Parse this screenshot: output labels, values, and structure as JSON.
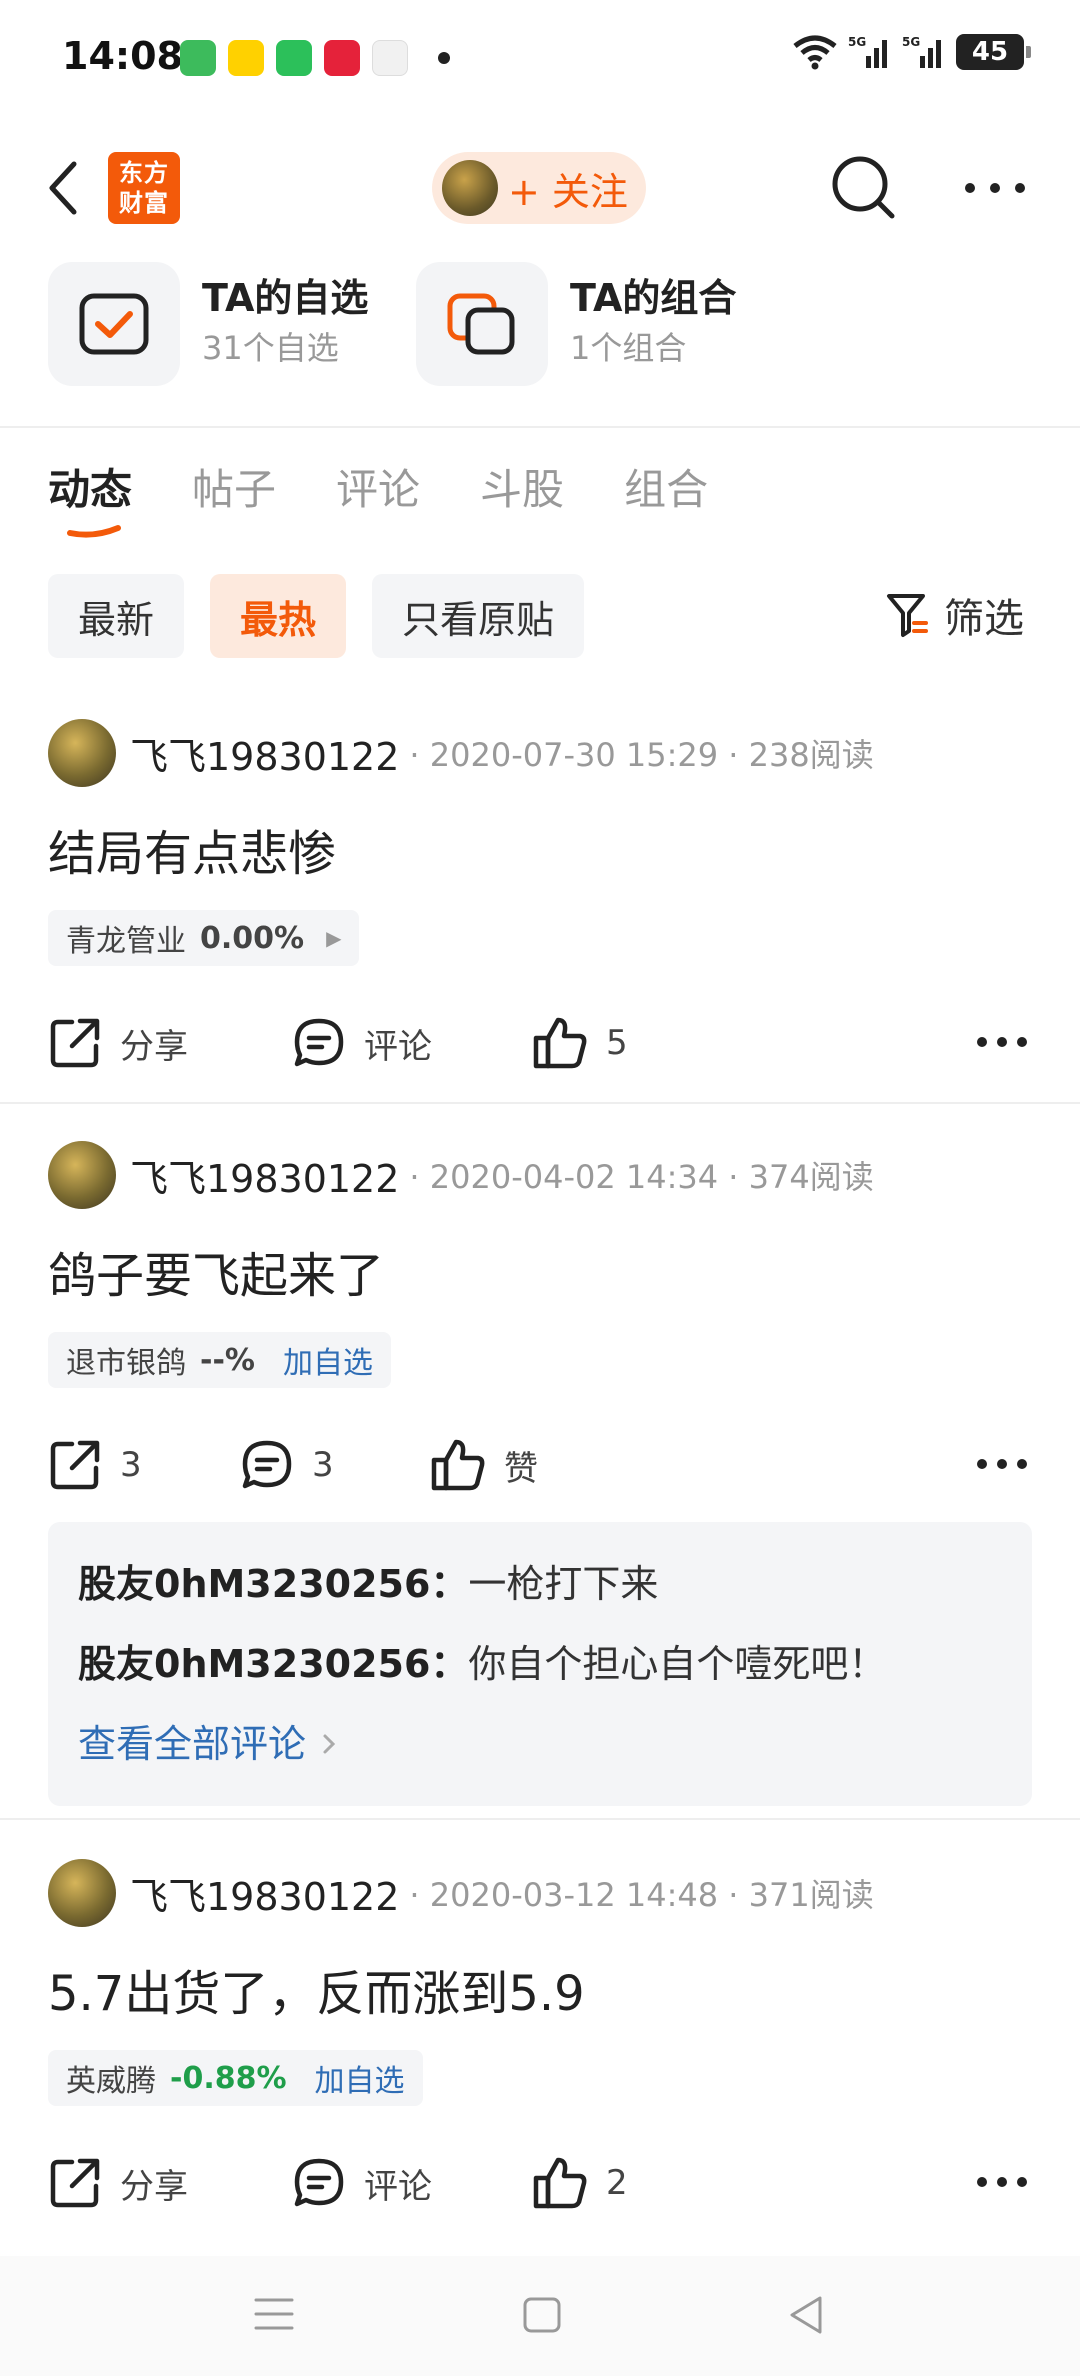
{
  "status_bar": {
    "time": "14:08",
    "battery": "45",
    "signal_1": "5G",
    "signal_2": "5G",
    "app_icons": [
      "messages-icon",
      "meituan-icon",
      "phone-icon",
      "gift-icon",
      "shield-icon"
    ]
  },
  "header": {
    "brand_logo": "东方财富",
    "follow_label": "+ 关注"
  },
  "shortcuts": [
    {
      "title": "TA的自选",
      "subtitle": "31个自选"
    },
    {
      "title": "TA的组合",
      "subtitle": "1个组合"
    }
  ],
  "tabs": [
    "动态",
    "帖子",
    "评论",
    "斗股",
    "组合"
  ],
  "filters": {
    "chips": [
      "最新",
      "最热",
      "只看原贴"
    ],
    "filter_label": "筛选"
  },
  "colors": {
    "accent": "#f35a0a",
    "link": "#2f6db5",
    "down": "#1f9e4a"
  },
  "posts": [
    {
      "author": "飞飞19830122",
      "meta": "· 2020-07-30 15:29 · 238阅读",
      "title": "结局有点悲惨",
      "stock": {
        "name": "青龙管业",
        "change": "0.00%"
      },
      "share": "分享",
      "comment": "评论",
      "likes": "5"
    },
    {
      "author": "飞飞19830122",
      "meta": "· 2020-04-02 14:34 · 374阅读",
      "title": "鸽子要飞起来了",
      "stock": {
        "name": "退市银鸽",
        "change": "--%",
        "add": "加自选"
      },
      "share": "3",
      "comment": "3",
      "likes": "赞",
      "comments": [
        {
          "user": "股友0hM3230256：",
          "text": "一枪打下来"
        },
        {
          "user": "股友0hM3230256：",
          "text": "你自个担心自个噎死吧！"
        }
      ],
      "view_all": "查看全部评论"
    },
    {
      "author": "飞飞19830122",
      "meta": "· 2020-03-12 14:48 · 371阅读",
      "title": "5.7出货了，反而涨到5.9",
      "stock": {
        "name": "英威腾",
        "change": "-0.88%",
        "add": "加自选"
      },
      "share": "分享",
      "comment": "评论",
      "likes": "2"
    }
  ]
}
